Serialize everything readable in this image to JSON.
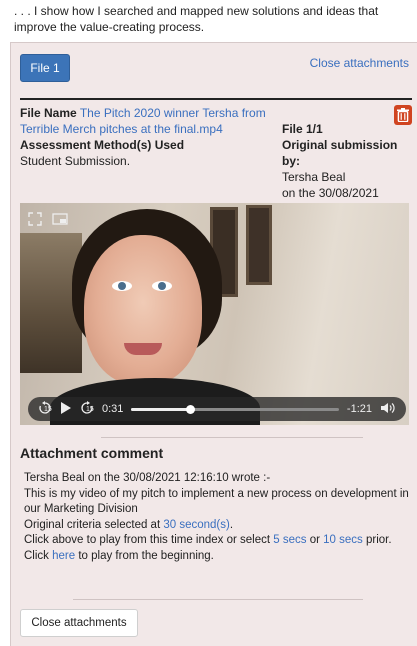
{
  "intro_text": ". . . I show how I searched and mapped new solutions and ideas that improve the value-creating process.",
  "tabs": [
    {
      "label": "File 1"
    }
  ],
  "close_attachments_link": "Close attachments",
  "file": {
    "name_label": "File Name",
    "name_value": "The Pitch 2020 winner Tersha from Terrible Merch pitches at the final.mp4",
    "assessment_label": "Assessment Method(s) Used",
    "assessment_value": "Student Submission.",
    "index": "File 1/1",
    "submission_label": "Original submission by:",
    "submitted_by": "Tersha Beal",
    "submitted_on": "on the 30/08/2021"
  },
  "video": {
    "current_time": "0:31",
    "remaining_time": "-1:21",
    "progress_fraction": 0.28,
    "skip_back_label": "15",
    "skip_forward_label": "15",
    "icons": [
      "fullscreen-icon",
      "picture-in-picture-icon",
      "skip-back-icon",
      "play-icon",
      "skip-forward-icon",
      "volume-icon"
    ]
  },
  "comment": {
    "title": "Attachment comment",
    "author_line": "Tersha Beal on the 30/08/2021 12:16:10 wrote :-",
    "text": "This is my video of my pitch to implement a new process on development in our Marketing Division",
    "criteria_prefix": "Original criteria selected at ",
    "criteria_link": "30 second(s)",
    "criteria_suffix": ".",
    "play_prefix": "Click above to play from this time index or select ",
    "five_secs": "5 secs",
    "or_word": " or ",
    "ten_secs": "10 secs",
    "play_suffix": " prior.",
    "click_word": "Click ",
    "here_link": "here",
    "beginning_suffix": " to play from the beginning."
  },
  "close_button_label": "Close attachments",
  "colors": {
    "accent": "#3c74b8",
    "link": "#3a6fbf",
    "panel_bg": "#f2e8e8",
    "trash": "#d04420"
  }
}
